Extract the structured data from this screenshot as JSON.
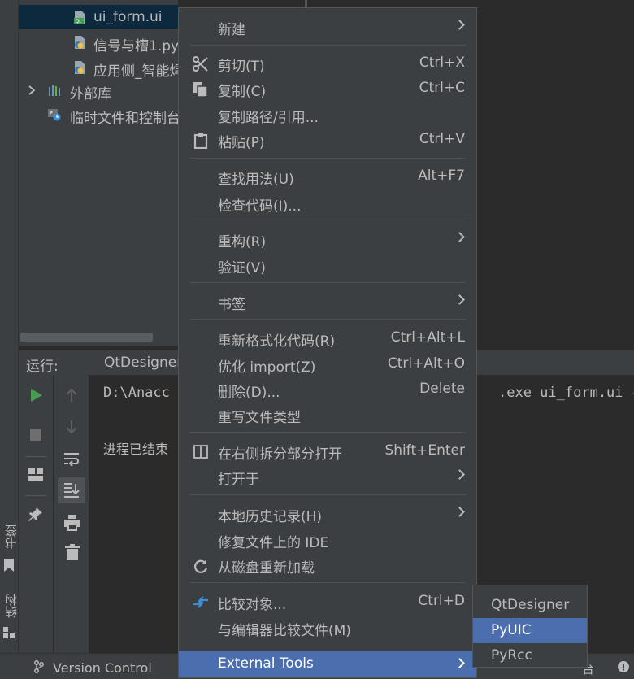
{
  "left_strip": {
    "bookmarks_label": "书签",
    "structure_label": "结构"
  },
  "tree": {
    "items": [
      {
        "label": "ui_form.ui",
        "icon": "qt-ui-file-icon"
      },
      {
        "label": "信号与槽1.py",
        "icon": "python-file-icon"
      },
      {
        "label": "应用侧_智能焊",
        "icon": "python-file-icon"
      },
      {
        "label": "外部库",
        "icon": "library-icon"
      },
      {
        "label": "临时文件和控制台",
        "icon": "scratch-icon"
      }
    ]
  },
  "run": {
    "label": "运行:",
    "tab": "QtDesigner",
    "output_line1": "D:\\Anacc",
    "output_line1_tail": ".exe ui_form.ui -",
    "output_line2": "进程已结束"
  },
  "statusbar": {
    "version_control": "Version Control",
    "tail_text": "台"
  },
  "menu": {
    "items": [
      {
        "label": "新建",
        "shortcut": "",
        "submenu": true
      },
      {
        "label": "剪切(T)",
        "shortcut": "Ctrl+X",
        "icon": "scissors-icon"
      },
      {
        "label": "复制(C)",
        "shortcut": "Ctrl+C",
        "icon": "copy-icon"
      },
      {
        "label": "复制路径/引用...",
        "shortcut": ""
      },
      {
        "label": "粘贴(P)",
        "shortcut": "Ctrl+V",
        "icon": "clipboard-icon"
      },
      {
        "label": "查找用法(U)",
        "shortcut": "Alt+F7"
      },
      {
        "label": "检查代码(I)...",
        "shortcut": ""
      },
      {
        "label": "重构(R)",
        "shortcut": "",
        "submenu": true
      },
      {
        "label": "验证(V)",
        "shortcut": ""
      },
      {
        "label": "书签",
        "shortcut": "",
        "submenu": true
      },
      {
        "label": "重新格式化代码(R)",
        "shortcut": "Ctrl+Alt+L"
      },
      {
        "label": "优化 import(Z)",
        "shortcut": "Ctrl+Alt+O"
      },
      {
        "label": "删除(D)...",
        "shortcut": "Delete"
      },
      {
        "label": "重写文件类型",
        "shortcut": ""
      },
      {
        "label": "在右侧拆分部分打开",
        "shortcut": "Shift+Enter",
        "icon": "split-right-icon"
      },
      {
        "label": "打开于",
        "shortcut": "",
        "submenu": true
      },
      {
        "label": "本地历史记录(H)",
        "shortcut": "",
        "submenu": true
      },
      {
        "label": "修复文件上的 IDE",
        "shortcut": ""
      },
      {
        "label": "从磁盘重新加载",
        "shortcut": "",
        "icon": "reload-icon"
      },
      {
        "label": "比较对象...",
        "shortcut": "Ctrl+D",
        "icon": "diff-icon"
      },
      {
        "label": "与编辑器比较文件(M)",
        "shortcut": ""
      },
      {
        "label": "External Tools",
        "shortcut": "",
        "submenu": true
      }
    ]
  },
  "submenu": {
    "items": [
      {
        "label": "QtDesigner"
      },
      {
        "label": "PyUIC"
      },
      {
        "label": "PyRcc"
      }
    ]
  },
  "colors": {
    "menu_bg": "#3c3f41",
    "highlight": "#4b6eaf",
    "text": "#bbbbbb",
    "run_green": "#499c54"
  }
}
